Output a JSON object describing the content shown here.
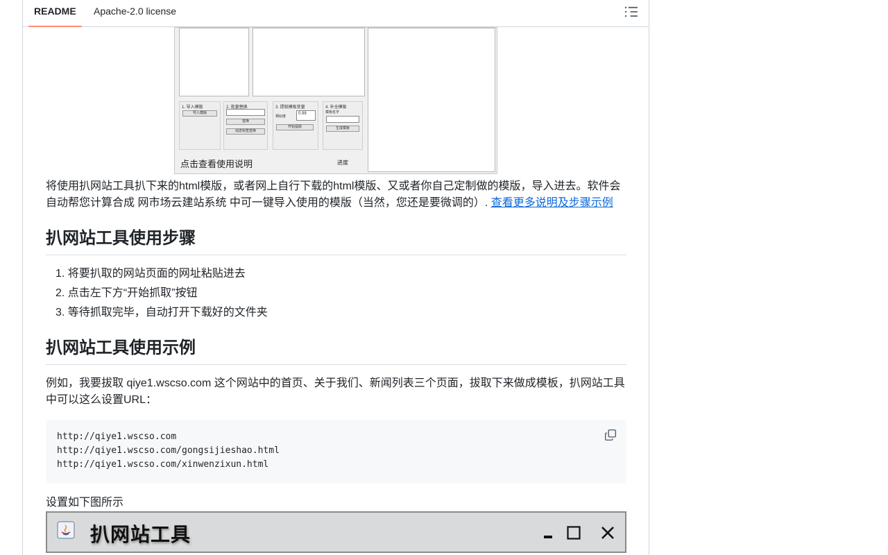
{
  "tabs": {
    "readme": "README",
    "license": "Apache-2.0 license"
  },
  "screenshot1": {
    "group1_title": "1. 导入模版",
    "group1_btn": "导入模版",
    "group2_title": "2. 批量替换",
    "group2_btn1": "替换",
    "group2_btn2": "动态标签替换",
    "group3_title": "3. 提取模板变量",
    "group3_label": "相似度",
    "group3_value": "0.98",
    "group3_btn": "开始提取",
    "group4_title": "4. 补全模板",
    "group4_label": "模板名字",
    "group4_btn": "生成模板",
    "link_text": "点击查看使用说明",
    "progress_label": "进度"
  },
  "intro": {
    "text_line1": "将使用扒网站工具扒下来的html模版，或者网上自行下载的html模版、又或者你自己定制做的模版，导入进去。软件会",
    "text_line2": "自动帮您计算合成 网市场云建站系统 中可一键导入使用的模版（当然，您还是要微调的）. ",
    "link": "查看更多说明及步骤示例"
  },
  "steps": {
    "heading": "扒网站工具使用步骤",
    "items": [
      "1. 将要扒取的网站页面的网址粘贴进去",
      "2. 点击左下方“开始抓取”按钮",
      "3. 等待抓取完毕，自动打开下载好的文件夹"
    ]
  },
  "example": {
    "heading": "扒网站工具使用示例",
    "text_line1": "例如，我要拔取 qiye1.wscso.com 这个网站中的首页、关于我们、新闻列表三个页面，拔取下来做成模板，扒网站工具",
    "text_line2": "中可以这么设置URL：",
    "code_lines": [
      "http://qiye1.wscso.com",
      "http://qiye1.wscso.com/gongsijieshao.html",
      "http://qiye1.wscso.com/xinwenzixun.html"
    ],
    "after_text": "设置如下图所示"
  },
  "screenshot2": {
    "title": "扒网站工具"
  },
  "colors": {
    "link": "#0969da",
    "tab_underline": "#fd8c73",
    "border": "#d0d7de",
    "code_bg": "#f6f8fa"
  }
}
